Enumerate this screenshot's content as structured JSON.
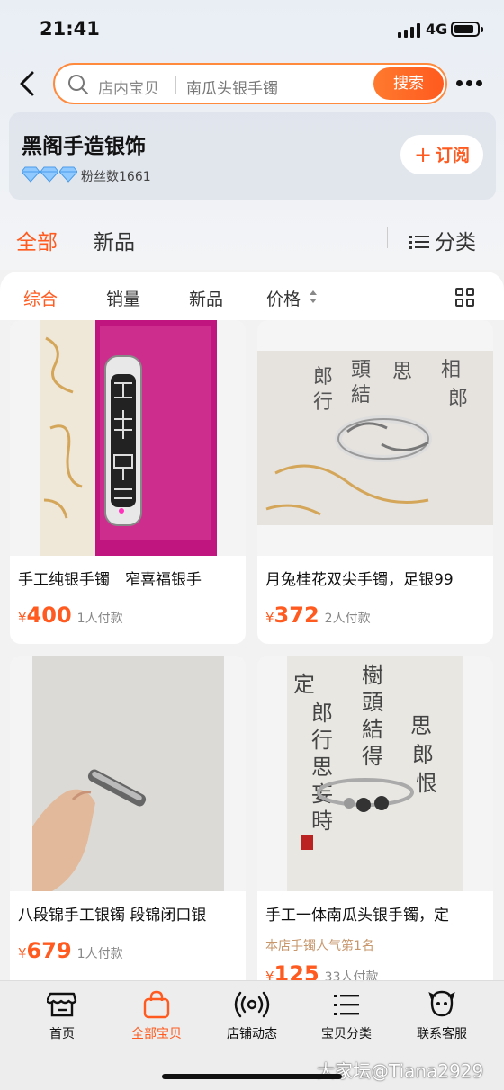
{
  "status_bar": {
    "time": "21:41",
    "network": "4G"
  },
  "search": {
    "placeholder": "店内宝贝",
    "query": "南瓜头银手镯",
    "button_label": "搜索"
  },
  "shop": {
    "name": "黑阁手造银饰",
    "fans": "粉丝数1661",
    "subscribe_label": "订阅",
    "diamond_count": 3
  },
  "top_tabs": {
    "all": "全部",
    "new": "新品",
    "category": "分类"
  },
  "sort_bar": {
    "comprehensive": "综合",
    "sales": "销量",
    "new": "新品",
    "price": "价格"
  },
  "products": [
    {
      "title": "手工纯银手镯　窄喜福银手",
      "currency": "¥",
      "price": "400",
      "sold": "1人付款",
      "image": "silver-bangle-on-pink-box"
    },
    {
      "title": "月兔桂花双尖手镯，足银99",
      "currency": "¥",
      "price": "372",
      "sold": "2人付款",
      "image": "silver-bangle-on-calligraphy"
    },
    {
      "title": "八段锦手工银镯  段锦闭口银",
      "currency": "¥",
      "price": "679",
      "sold": "1人付款",
      "image": "hand-holding-bangle"
    },
    {
      "title": "手工一体南瓜头银手镯，定",
      "rank": "本店手镯人气第1名",
      "currency": "¥",
      "price": "125",
      "sold": "33人付款",
      "image": "pumpkin-head-bangle-on-calligraphy"
    }
  ],
  "tab_bar": [
    {
      "label": "首页",
      "icon": "shop-home-icon"
    },
    {
      "label": "全部宝贝",
      "icon": "shopping-bag-icon"
    },
    {
      "label": "店铺动态",
      "icon": "broadcast-icon"
    },
    {
      "label": "宝贝分类",
      "icon": "list-icon"
    },
    {
      "label": "联系客服",
      "icon": "service-face-icon"
    }
  ],
  "watermark": "大家坛@Tiana2929",
  "colors": {
    "accent": "#ff5a1f",
    "rank_text": "#c7966b"
  }
}
